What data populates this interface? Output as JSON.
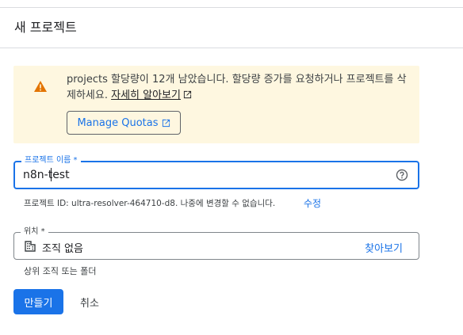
{
  "dialog": {
    "title": "새 프로젝트"
  },
  "notice": {
    "text": "projects 할당량이 12개 남았습니다. 할당량 증가를 요청하거나 프로젝트를 삭제하세요. ",
    "learn_more": "자세히 알아보기",
    "manage_quotas": "Manage Quotas",
    "icon": "warning-icon",
    "colors": {
      "background": "#fef7e0",
      "icon": "#e37400"
    }
  },
  "project_name": {
    "label": "프로젝트 이름 *",
    "value": "n8n-test",
    "help_icon": "help-circle-icon"
  },
  "project_id": {
    "text": "프로젝트 ID: ultra-resolver-464710-d8. 나중에 변경할 수 없습니다.",
    "edit": "수정"
  },
  "location": {
    "label": "위치 *",
    "value": "조직 없음",
    "browse": "찾아보기",
    "helper": "상위 조직 또는 폴더",
    "icon": "building-icon"
  },
  "actions": {
    "create": "만들기",
    "cancel": "취소"
  },
  "colors": {
    "accent": "#1a73e8"
  }
}
